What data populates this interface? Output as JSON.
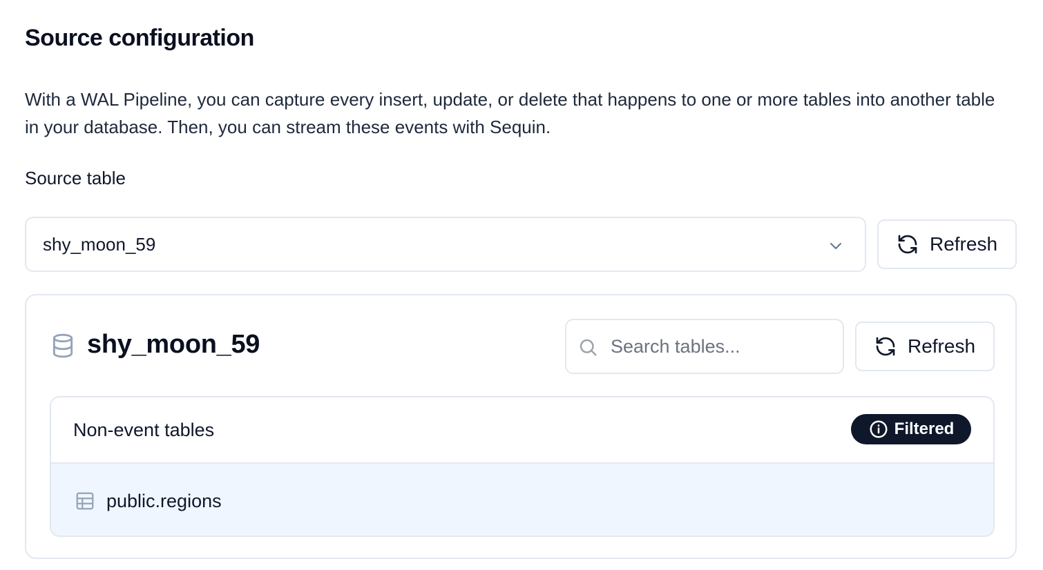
{
  "page": {
    "title": "Source configuration",
    "description": "With a WAL Pipeline, you can capture every insert, update, or delete that happens to one or more tables into another table in your database. Then, you can stream these events with Sequin."
  },
  "source_table": {
    "label": "Source table",
    "selected": "shy_moon_59",
    "refresh_label": "Refresh"
  },
  "database": {
    "name": "shy_moon_59",
    "search_placeholder": "Search tables...",
    "search_value": "",
    "refresh_label": "Refresh",
    "section": {
      "title": "Non-event tables",
      "badge": "Filtered",
      "tables": [
        "public.regions"
      ]
    }
  },
  "colors": {
    "badge_bg": "#0f172a",
    "row_highlight": "#eff6ff",
    "border": "#e2e8f0"
  },
  "icons": [
    "chevron-down-icon",
    "refresh-icon",
    "database-icon",
    "search-icon",
    "info-icon",
    "table-icon"
  ]
}
